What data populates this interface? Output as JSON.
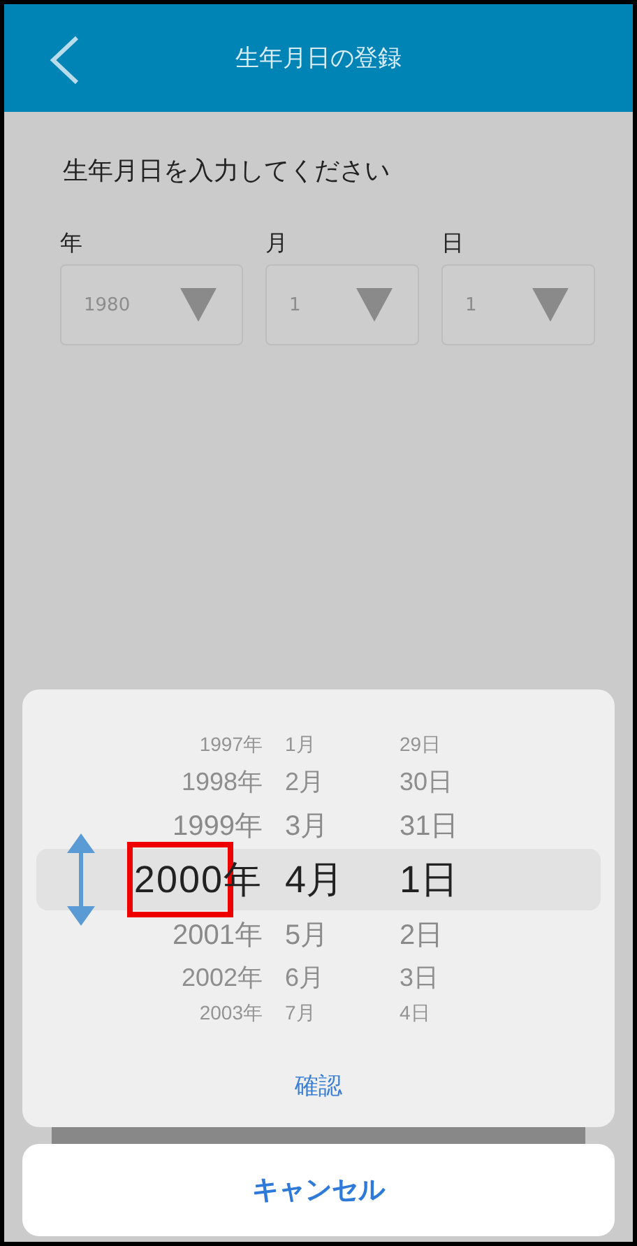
{
  "header": {
    "title": "生年月日の登録"
  },
  "prompt": "生年月日を入力してください",
  "fields": [
    {
      "label": "年",
      "value": "1980"
    },
    {
      "label": "月",
      "value": "1"
    },
    {
      "label": "日",
      "value": "1"
    }
  ],
  "picker": {
    "rows": [
      {
        "year": "1997年",
        "month": "1月",
        "day": "29日",
        "selected": false
      },
      {
        "year": "1998年",
        "month": "2月",
        "day": "30日",
        "selected": false
      },
      {
        "year": "1999年",
        "month": "3月",
        "day": "31日",
        "selected": false
      },
      {
        "year": "2000年",
        "month": "4月",
        "day": "1日",
        "selected": true
      },
      {
        "year": "2001年",
        "month": "5月",
        "day": "2日",
        "selected": false
      },
      {
        "year": "2002年",
        "month": "6月",
        "day": "3日",
        "selected": false
      },
      {
        "year": "2003年",
        "month": "7月",
        "day": "4日",
        "selected": false
      }
    ],
    "confirm": "確認"
  },
  "cancel": "キャンセル"
}
